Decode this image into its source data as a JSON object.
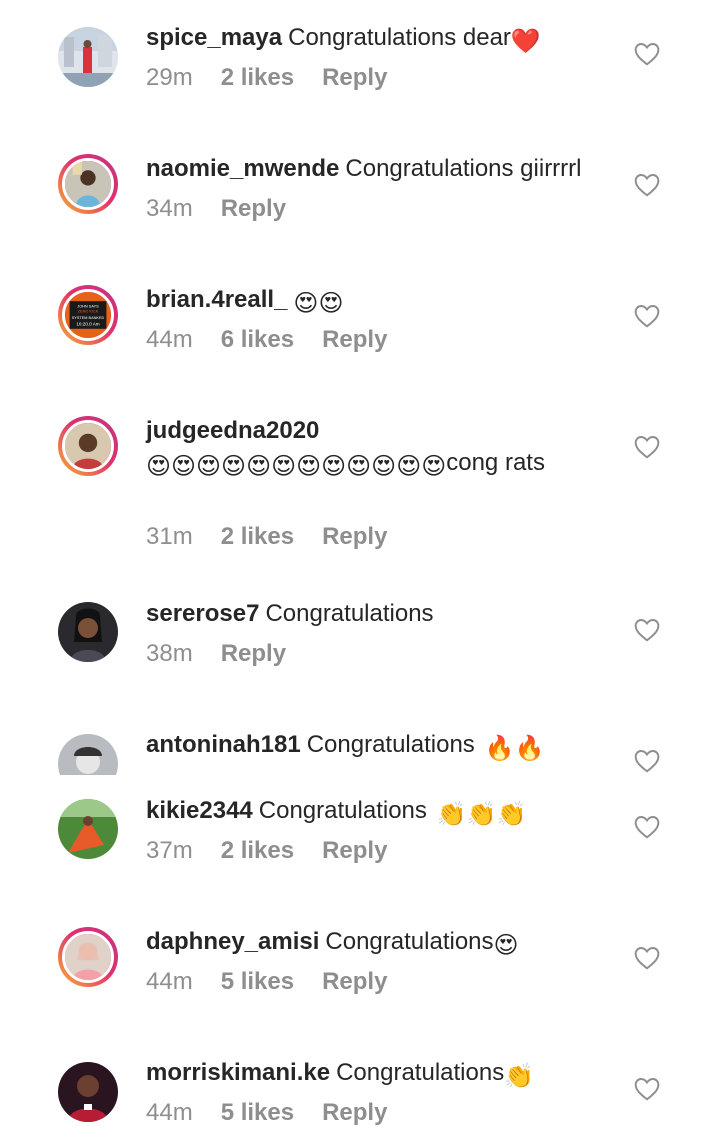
{
  "comments": [
    {
      "username": "spice_maya",
      "text": "Congratulations dear",
      "emoji": "❤️",
      "time": "29m",
      "likes": "2 likes",
      "reply": "Reply"
    },
    {
      "username": "naomie_mwende",
      "text": "Congratulations giirrrrl",
      "emoji": "",
      "time": "34m",
      "likes": "",
      "reply": "Reply"
    },
    {
      "username": "brian.4reall_",
      "text": "",
      "emoji": "😍😍",
      "time": "44m",
      "likes": "6 likes",
      "reply": "Reply"
    },
    {
      "username": "judgeedna2020",
      "text": "",
      "emoji": "😍😍😍😍😍😍😍😍😍😍😍😍",
      "text_after": "cong rats",
      "time": "31m",
      "likes": "2 likes",
      "reply": "Reply"
    },
    {
      "username": "sererose7",
      "text": "Congratulations",
      "emoji": "",
      "time": "38m",
      "likes": "",
      "reply": "Reply"
    },
    {
      "username": "antoninah181",
      "text": "Congratulations",
      "emoji": "🔥🔥",
      "time": "",
      "likes": "",
      "reply": ""
    },
    {
      "username": "kikie2344",
      "text": "Congratulations",
      "emoji": "👏👏👏",
      "time": "37m",
      "likes": "2 likes",
      "reply": "Reply"
    },
    {
      "username": "daphney_amisi",
      "text": "Congratulations",
      "emoji": "😍",
      "time": "44m",
      "likes": "5 likes",
      "reply": "Reply"
    },
    {
      "username": "morriskimani.ke",
      "text": "Congratulations",
      "emoji": "👏",
      "time": "44m",
      "likes": "5 likes",
      "reply": "Reply"
    }
  ],
  "avatar_text": {
    "line1": "JOHN SAYS",
    "line2": "ZERO KICK",
    "line3": "SYSTEM BANKED",
    "line4": "10:20.0 Am"
  },
  "colors": {
    "text": "#262626",
    "meta": "#8e8e8e",
    "heart": "#8e8e8e",
    "ring_start": "#f9b234",
    "ring_end": "#c13584"
  }
}
